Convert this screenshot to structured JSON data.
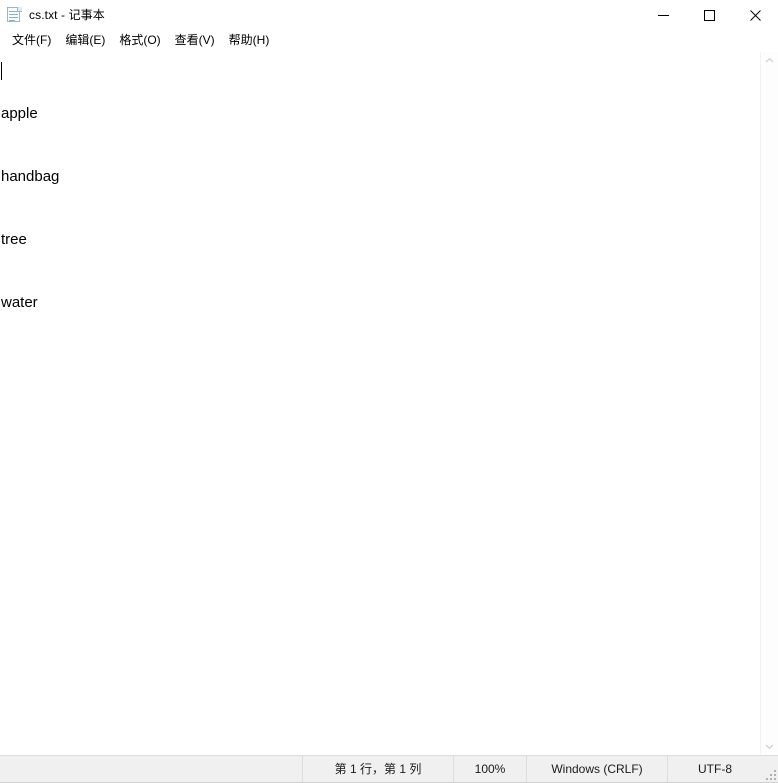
{
  "window": {
    "title": "cs.txt - 记事本",
    "app_icon": "notepad-document-icon",
    "controls": {
      "minimize_label": "最小化",
      "maximize_label": "最大化",
      "close_label": "关闭"
    }
  },
  "menubar": {
    "items": [
      {
        "label": "文件(F)",
        "name": "menu-file"
      },
      {
        "label": "编辑(E)",
        "name": "menu-edit"
      },
      {
        "label": "格式(O)",
        "name": "menu-format"
      },
      {
        "label": "查看(V)",
        "name": "menu-view"
      },
      {
        "label": "帮助(H)",
        "name": "menu-help"
      }
    ]
  },
  "editor": {
    "lines": [
      "apple",
      "handbag",
      "tree",
      "water"
    ],
    "caret_line": 1,
    "caret_column": 1
  },
  "scrollbar": {
    "up_icon": "chevron-up-icon",
    "down_icon": "chevron-down-icon"
  },
  "statusbar": {
    "position": "第 1 行，第 1 列",
    "zoom": "100%",
    "line_ending": "Windows (CRLF)",
    "encoding": "UTF-8"
  },
  "colors": {
    "window_bg": "#ffffff",
    "statusbar_bg": "#f0f0f0",
    "text": "#000000",
    "separator": "#dedede",
    "close_hover": "#e81123"
  }
}
